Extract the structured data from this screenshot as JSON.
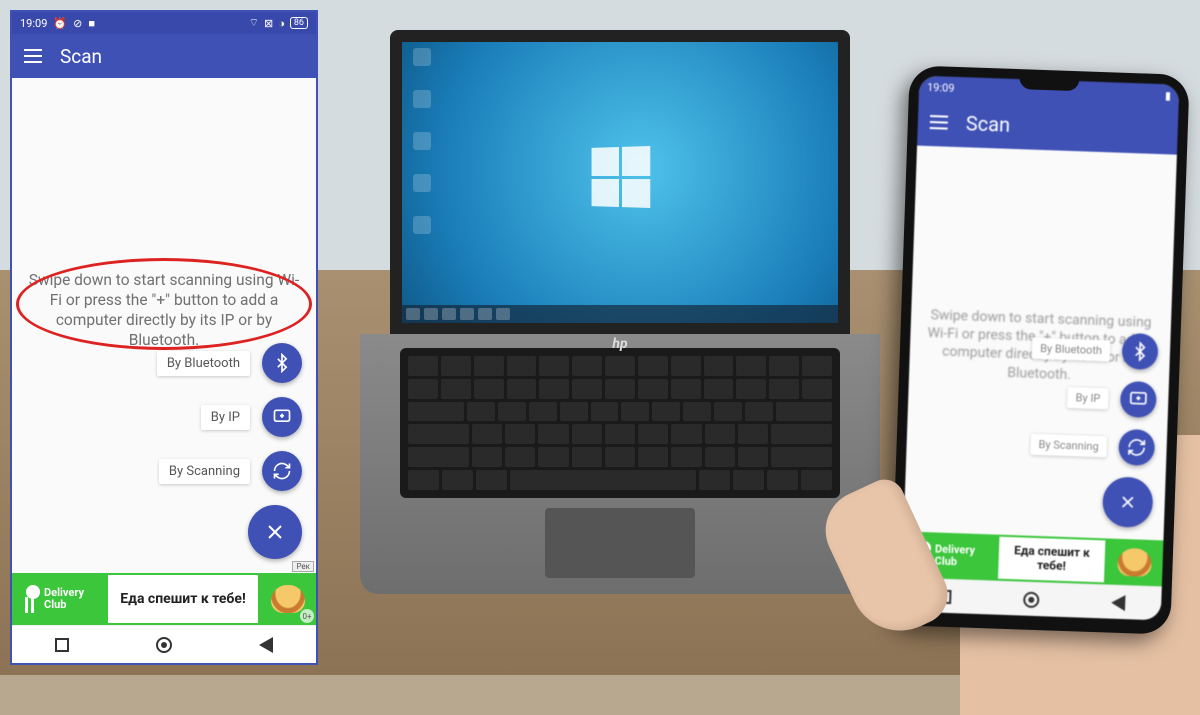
{
  "status": {
    "time": "19:09",
    "battery": "86"
  },
  "appbar": {
    "title": "Scan"
  },
  "hint": "Swipe down to start scanning using Wi-Fi or press the \"+\" button to add a computer directly by its IP or by Bluetooth.",
  "fabs": {
    "bluetooth": "By Bluetooth",
    "ip": "By IP",
    "scanning": "By Scanning"
  },
  "ad": {
    "brand_line1": "Delivery",
    "brand_line2": "Club",
    "text": "Еда спешит к тебе!",
    "tag": "Рек",
    "age": "0+"
  },
  "laptop": {
    "brand": "hp"
  },
  "colors": {
    "primary": "#3F51B5",
    "primary_dark": "#3949AB",
    "ad_green": "#3bc63b",
    "highlight_red": "#d22"
  }
}
